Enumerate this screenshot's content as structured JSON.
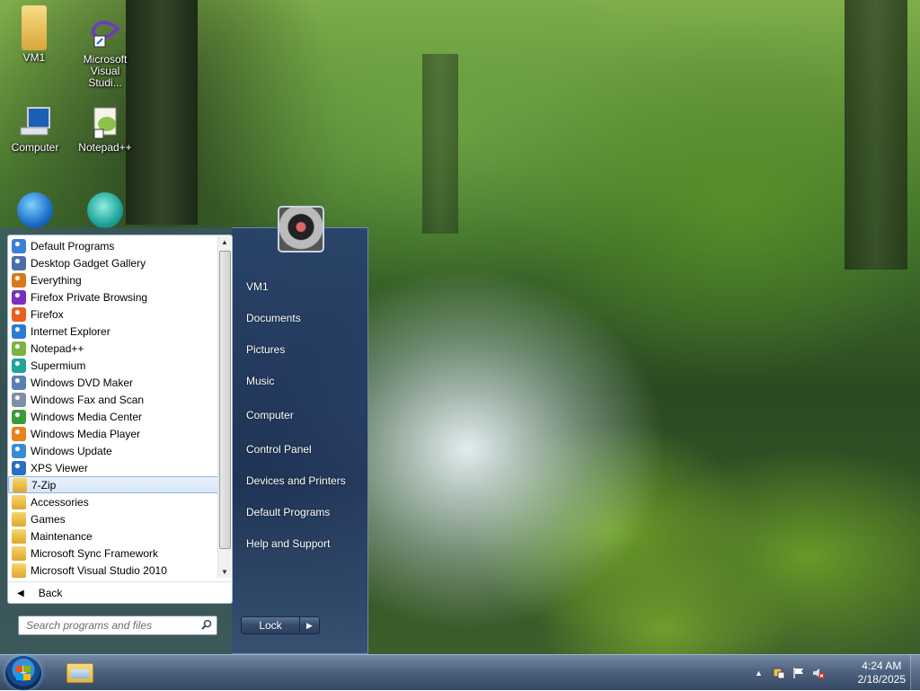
{
  "desktop": {
    "icons": [
      {
        "label": "VM1",
        "icon": "user-folder-icon"
      },
      {
        "label": "Microsoft Visual Studi...",
        "icon": "visual-studio-icon"
      },
      {
        "label": "Computer",
        "icon": "computer-icon"
      },
      {
        "label": "Notepad++",
        "icon": "notepad-plus-plus-icon"
      },
      {
        "label": "",
        "icon": "network-icon"
      },
      {
        "label": "",
        "icon": "supermium-icon"
      }
    ]
  },
  "start_menu": {
    "programs": [
      {
        "label": "Default Programs",
        "icon": "default-programs-icon",
        "color": "#3b7fd6"
      },
      {
        "label": "Desktop Gadget Gallery",
        "icon": "gadget-gallery-icon",
        "color": "#4a6fa5"
      },
      {
        "label": "Everything",
        "icon": "everything-search-icon",
        "color": "#d87a1c"
      },
      {
        "label": "Firefox Private Browsing",
        "icon": "firefox-private-icon",
        "color": "#7b2fbf"
      },
      {
        "label": "Firefox",
        "icon": "firefox-icon",
        "color": "#e8601c"
      },
      {
        "label": "Internet Explorer",
        "icon": "internet-explorer-icon",
        "color": "#2b7bd1"
      },
      {
        "label": "Notepad++",
        "icon": "notepad-plus-plus-icon",
        "color": "#7cb342"
      },
      {
        "label": "Supermium",
        "icon": "supermium-icon",
        "color": "#1fa39a"
      },
      {
        "label": "Windows DVD Maker",
        "icon": "dvd-maker-icon",
        "color": "#5a7fb0"
      },
      {
        "label": "Windows Fax and Scan",
        "icon": "fax-scan-icon",
        "color": "#7f8fa6"
      },
      {
        "label": "Windows Media Center",
        "icon": "media-center-icon",
        "color": "#3c9a3c"
      },
      {
        "label": "Windows Media Player",
        "icon": "media-player-icon",
        "color": "#e5841b"
      },
      {
        "label": "Windows Update",
        "icon": "windows-update-icon",
        "color": "#3a8ad6"
      },
      {
        "label": "XPS Viewer",
        "icon": "xps-viewer-icon",
        "color": "#2a6ebf"
      },
      {
        "label": "7-Zip",
        "icon": "folder-icon",
        "selected": true
      },
      {
        "label": "Accessories",
        "icon": "folder-icon"
      },
      {
        "label": "Games",
        "icon": "folder-icon"
      },
      {
        "label": "Maintenance",
        "icon": "folder-icon"
      },
      {
        "label": "Microsoft Sync Framework",
        "icon": "folder-icon"
      },
      {
        "label": "Microsoft Visual Studio 2010",
        "icon": "folder-icon"
      }
    ],
    "back_label": "Back",
    "search_placeholder": "Search programs and files",
    "right_items": [
      {
        "label": "VM1",
        "name": "user-folder-link"
      },
      {
        "label": "Documents",
        "name": "documents-link"
      },
      {
        "label": "Pictures",
        "name": "pictures-link"
      },
      {
        "label": "Music",
        "name": "music-link"
      },
      {
        "label": "Computer",
        "name": "computer-link"
      },
      {
        "label": "Control Panel",
        "name": "control-panel-link"
      },
      {
        "label": "Devices and Printers",
        "name": "devices-printers-link"
      },
      {
        "label": "Default Programs",
        "name": "default-programs-link"
      },
      {
        "label": "Help and Support",
        "name": "help-support-link"
      }
    ],
    "lock_label": "Lock"
  },
  "taskbar": {
    "clock_time": "4:24 AM",
    "clock_date": "2/18/2025",
    "tray_icons": [
      "show-hidden-icons-arrow",
      "action-center-icon",
      "flag-icon",
      "volume-muted-icon"
    ]
  }
}
